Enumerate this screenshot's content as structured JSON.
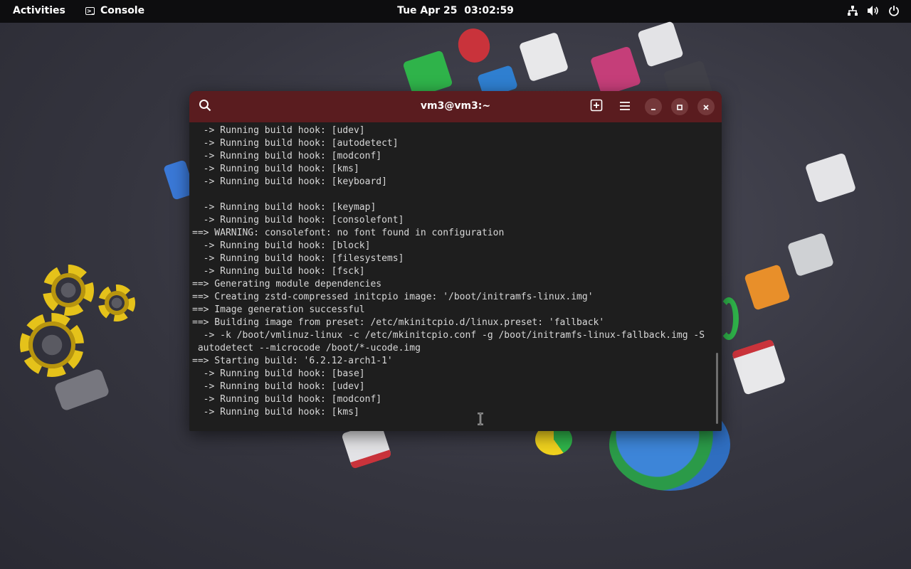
{
  "topbar": {
    "activities": "Activities",
    "app_name": "Console",
    "clock": "Tue Apr 25  03:02:59",
    "tray_icons": [
      "network-icon",
      "volume-icon",
      "power-icon"
    ]
  },
  "terminal": {
    "title": "vm3@vm3:~",
    "header_icons": [
      "search-icon",
      "new-tab-icon",
      "menu-icon",
      "minimize-icon",
      "maximize-icon",
      "close-icon"
    ],
    "lines": [
      "  -> Running build hook: [udev]",
      "  -> Running build hook: [autodetect]",
      "  -> Running build hook: [modconf]",
      "  -> Running build hook: [kms]",
      "  -> Running build hook: [keyboard]",
      "",
      "  -> Running build hook: [keymap]",
      "  -> Running build hook: [consolefont]",
      "==> WARNING: consolefont: no font found in configuration",
      "  -> Running build hook: [block]",
      "  -> Running build hook: [filesystems]",
      "  -> Running build hook: [fsck]",
      "==> Generating module dependencies",
      "==> Creating zstd-compressed initcpio image: '/boot/initramfs-linux.img'",
      "==> Image generation successful",
      "==> Building image from preset: /etc/mkinitcpio.d/linux.preset: 'fallback'",
      "  -> -k /boot/vmlinuz-linux -c /etc/mkinitcpio.conf -g /boot/initramfs-linux-fallback.img -S",
      " autodetect --microcode /boot/*-ucode.img",
      "==> Starting build: '6.2.12-arch1-1'",
      "  -> Running build hook: [base]",
      "  -> Running build hook: [udev]",
      "  -> Running build hook: [modconf]",
      "  -> Running build hook: [kms]"
    ]
  },
  "colors": {
    "topbar_bg": "#0d0d0f",
    "header_bg": "#5a1c1f",
    "terminal_bg": "#1e1e1e",
    "terminal_fg": "#d8d8d8"
  }
}
